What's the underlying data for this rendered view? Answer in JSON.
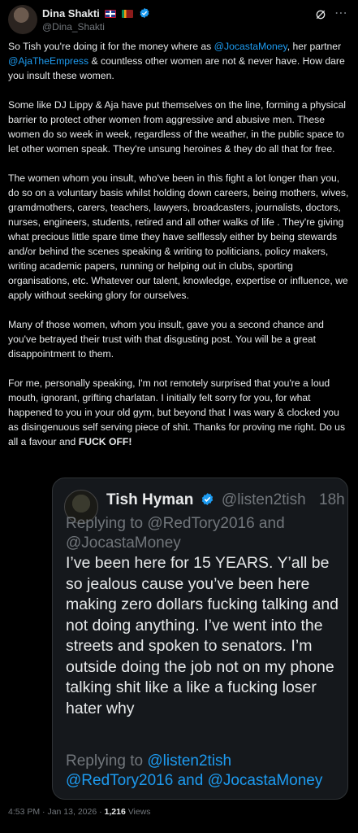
{
  "author": {
    "name": "Dina Shakti",
    "handle": "@Dina_Shakti",
    "flags": [
      "uk-flag",
      "sri-lanka-flag"
    ],
    "verified": true
  },
  "body": {
    "p1_a": "So Tish you're doing it for the money where as ",
    "p1_m1": "@JocastaMoney",
    "p1_b": ", her partner ",
    "p1_m2": "@AjaTheEmpress",
    "p1_c": " & countless other women are not & never have. How dare you insult these women.",
    "p2": "Some like DJ Lippy & Aja have put themselves on the line, forming a physical barrier to protect other women from aggressive and abusive men. These women do so week in week, regardless of the weather, in the public space to let other women speak. They're unsung heroines & they do all that for free.",
    "p3": "The women whom you insult, who've been in this fight a lot longer than you, do so on a voluntary basis whilst holding down careers, being mothers, wives, gramdmothers, carers, teachers, lawyers, broadcasters, journalists, doctors, nurses, engineers, students, retired and all other walks of life . They're giving what precious little spare time they have selflessly either by being stewards and/or behind the scenes speaking & writing to politicians, policy makers, writing academic papers, running  or helping out in clubs, sporting organisations, etc. Whatever our talent, knowledge, expertise or influence, we apply without seeking glory for ourselves.",
    "p4": "Many of those women, whom you insult, gave you a second chance and you've betrayed their trust with that disgusting post. You will be a great disappointment to them.",
    "p5_a": "For me, personally speaking, I'm not remotely surprised that you're a loud mouth, ignorant, grifting charlatan. I initially felt sorry for you, for what happened to you in your old gym, but beyond that I was wary & clocked you as disingenuous self serving piece of shit. Thanks for proving me right. Do us all a favour and ",
    "p5_bold": "FUCK OFF!"
  },
  "quote": {
    "name": "Tish Hyman",
    "handle": "@listen2tish",
    "time": "18h",
    "replying_label": "Replying to ",
    "replying_1": "@RedTory2016",
    "replying_and": " and",
    "replying_2": "@JocastaMoney",
    "text": "I’ve been here for 15 YEARS. Y’all be so jealous cause you’ve been here making zero dollars fucking talking and not doing anything. I’ve went into the streets and spoken to senators. I’m outside doing the job not on my phone talking shit like a like a fucking loser hater why",
    "replying2_label": "Replying to ",
    "replying2_1": "@listen2tish",
    "replying2_2": "@RedTory2016 and @JocastaMoney"
  },
  "meta": {
    "time": "4:53 PM",
    "sep": " · ",
    "date": "Jan 13, 2026",
    "views_count": "1,216",
    "views_label": " Views"
  },
  "colors": {
    "background": "#000000",
    "text": "#e7e9ea",
    "muted": "#71767b",
    "accent": "#1d9bf0"
  }
}
